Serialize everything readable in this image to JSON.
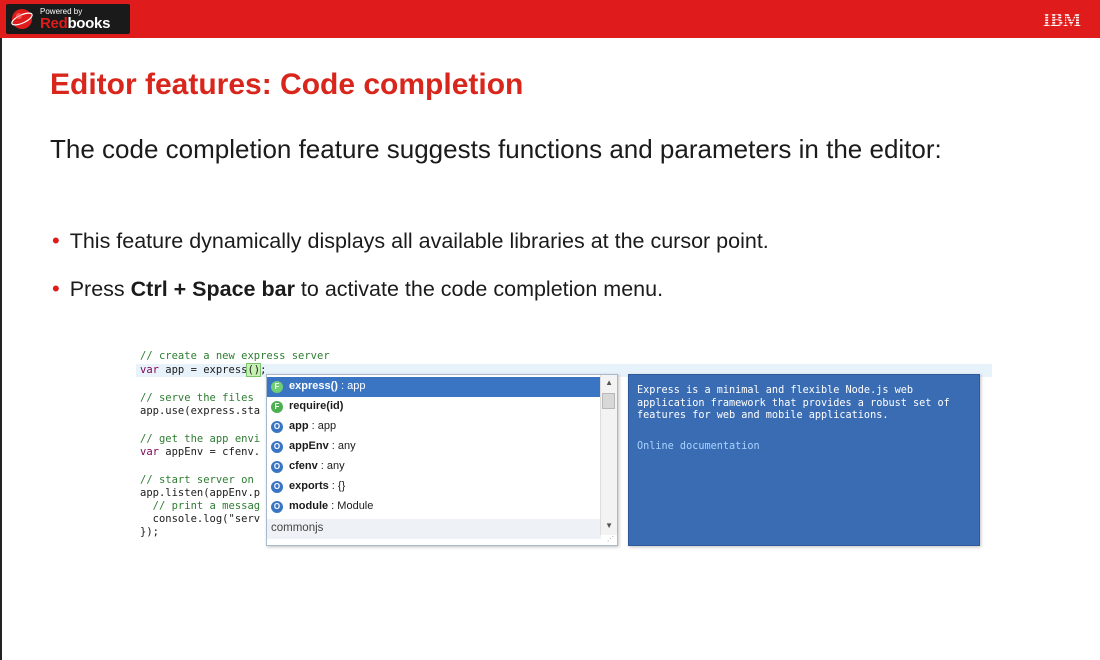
{
  "header": {
    "logo_powered": "Powered by",
    "logo_brand_red": "Red",
    "logo_brand_white": "books",
    "ibm_logo": "IBM",
    "icons": [
      "redbooks-globe-icon",
      "ibm-logo-icon"
    ],
    "colors": {
      "bar": "#e01b1b",
      "title": "#d9261c",
      "bullet": "#e01b1b"
    }
  },
  "slide": {
    "title": "Editor features: Code completion",
    "intro": "The code completion feature suggests functions and parameters in the editor:",
    "bullets": [
      {
        "before": "This feature dynamically displays all available libraries at the cursor point.",
        "bold": "",
        "after": ""
      },
      {
        "before": "Press ",
        "bold": "Ctrl + Space bar",
        "after": " to activate the code completion menu."
      }
    ]
  },
  "editor": {
    "code": {
      "comment_create": "// create a new express server",
      "var_kw": "var",
      "app_assign": " app = express",
      "app_parens": "()",
      "app_semicolon": ";",
      "comment_serve": "// serve the files",
      "app_use": "app.use(express.sta",
      "comment_get": "// get the app envi",
      "var_kw2": "var",
      "appenv_assign": " appEnv = cfenv.",
      "comment_start": "// start server on",
      "app_listen": "app.listen(appEnv.p",
      "comment_print": "  // print a messag",
      "console_log": "  console.log(\"serv",
      "close": "});"
    },
    "completion": {
      "proposals": [
        {
          "name": "express()",
          "type": " : app",
          "kind": "function",
          "selected": true
        },
        {
          "name": "require(id)",
          "type": "",
          "kind": "function",
          "selected": false
        },
        {
          "name": "app",
          "type": " : app",
          "kind": "object",
          "selected": false
        },
        {
          "name": "appEnv",
          "type": " : any",
          "kind": "object",
          "selected": false
        },
        {
          "name": "cfenv",
          "type": " : any",
          "kind": "object",
          "selected": false
        },
        {
          "name": "exports",
          "type": " : {}",
          "kind": "object",
          "selected": false
        },
        {
          "name": "module",
          "type": " : Module",
          "kind": "object",
          "selected": false
        }
      ],
      "icon_function": "F",
      "icon_object": "O",
      "group_header": "commonjs"
    },
    "doc": {
      "description": "Express is a minimal and flexible Node.js web application framework that provides a robust set of features for web and mobile applications.",
      "link": "Online documentation"
    }
  }
}
